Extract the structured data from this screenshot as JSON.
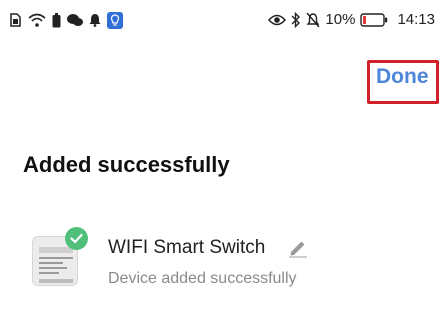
{
  "status_bar": {
    "battery_percent": "10%",
    "time": "14:13",
    "left_icons": [
      "sim-card-icon",
      "wifi-icon",
      "battery-saver-icon",
      "chat-icon",
      "bell-icon",
      "bulb-app-icon"
    ],
    "right_icons": [
      "eye-icon",
      "bluetooth-icon",
      "mute-bell-icon",
      "battery-icon"
    ]
  },
  "header": {
    "done_label": "Done",
    "accent_color": "#4d86d9",
    "highlight_color": "#d0202a"
  },
  "main": {
    "title": "Added successfully",
    "device": {
      "name": "WIFI Smart Switch",
      "status": "Device added successfully",
      "status_icon": "check-icon",
      "status_color": "#4fbf7a"
    }
  }
}
